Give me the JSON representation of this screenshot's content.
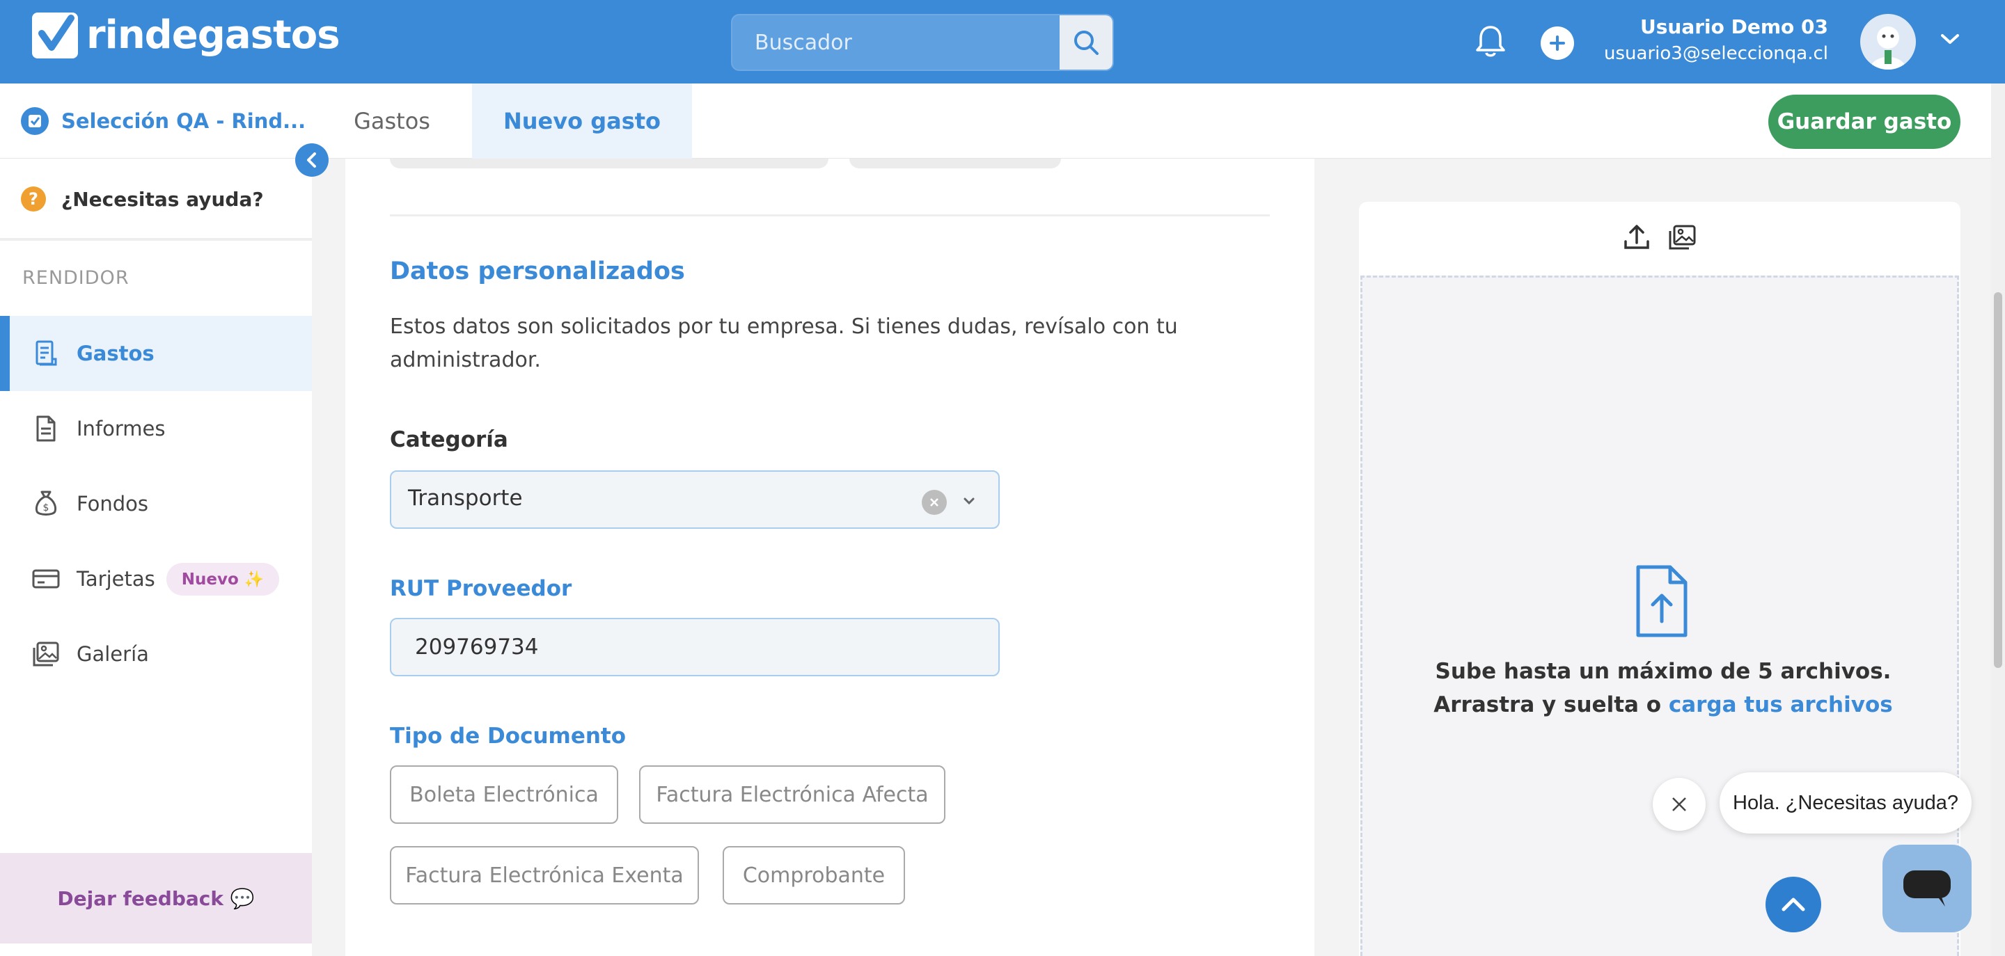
{
  "header": {
    "logo_text": "rindegastos",
    "search_placeholder": "Buscador",
    "user_name": "Usuario Demo 03",
    "user_email": "usuario3@seleccionqa.cl"
  },
  "subnav": {
    "company": "Selección QA - Rind...",
    "tabs": [
      {
        "label": "Gastos",
        "active": false
      },
      {
        "label": "Nuevo gasto",
        "active": true
      }
    ],
    "save_label": "Guardar gasto"
  },
  "sidebar": {
    "help_label": "¿Necesitas ayuda?",
    "section_label": "RENDIDOR",
    "items": [
      {
        "label": "Gastos",
        "icon": "receipt-icon",
        "active": true
      },
      {
        "label": "Informes",
        "icon": "document-icon",
        "active": false
      },
      {
        "label": "Fondos",
        "icon": "money-bag-icon",
        "active": false
      },
      {
        "label": "Tarjetas",
        "icon": "credit-card-icon",
        "active": false,
        "badge": "Nuevo ✨"
      },
      {
        "label": "Galería",
        "icon": "gallery-icon",
        "active": false
      }
    ],
    "feedback_label": "Dejar feedback 💬"
  },
  "form": {
    "section_title": "Datos personalizados",
    "description": "Estos datos son solicitados por tu empresa. Si tienes dudas, revísalo con tu administrador.",
    "categoria_label": "Categoría",
    "categoria_value": "Transporte",
    "rut_label": "RUT Proveedor",
    "rut_value": "209769734",
    "tipo_label": "Tipo de Documento",
    "tipo_options": [
      "Boleta Electrónica",
      "Factura Electrónica Afecta",
      "Factura Electrónica Exenta",
      "Comprobante"
    ]
  },
  "upload": {
    "line1": "Sube hasta un máximo de 5 archivos.",
    "line2_prefix": "Arrastra y suelta o ",
    "line2_link": "carga tus archivos"
  },
  "chat": {
    "bubble_text": "Hola. ¿Necesitas ayuda?"
  },
  "colors": {
    "primary": "#3a8ad8",
    "save_green": "#3d9d5f",
    "badge_purple": "#a04aa0"
  }
}
